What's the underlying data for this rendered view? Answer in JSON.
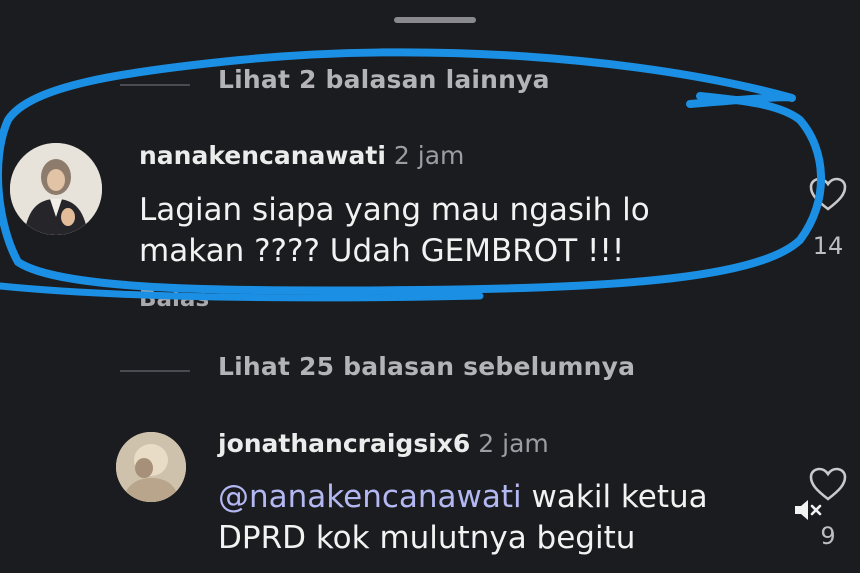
{
  "thread": {
    "view_more_top": "Lihat 2 balasan lainnya",
    "view_previous": "Lihat 25 balasan sebelumnya"
  },
  "comments": [
    {
      "username": "nanakencanawati",
      "time": "2 jam",
      "line1": "Lagian siapa yang mau ngasih lo",
      "line2": "makan ???? Udah GEMBROT !!!",
      "reply_label": "Balas",
      "likes": "14",
      "avatar_icon": "avatar-photo"
    },
    {
      "username": "jonathancraigsix6",
      "time": "2 jam",
      "mention": "@nanakencanawati",
      "line1_rest": " wakil ketua",
      "line2": "DPRD kok mulutnya begitu",
      "likes": "9",
      "avatar_icon": "avatar-photo"
    }
  ],
  "icons": {
    "heart": "heart-outline-icon",
    "mute": "speaker-muted-icon"
  },
  "colors": {
    "background": "#1b1c1f",
    "annotation": "#1a8fe3",
    "mention": "#b4b8f2"
  }
}
